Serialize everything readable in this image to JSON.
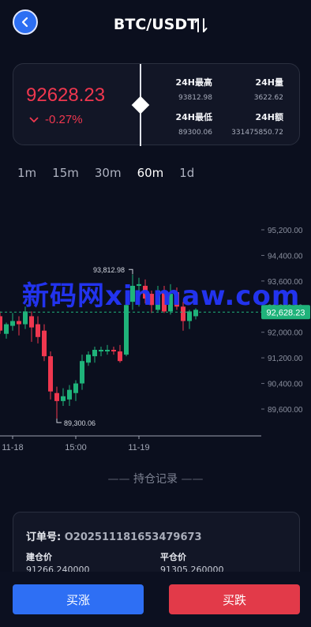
{
  "header": {
    "title": "BTC/USDT",
    "back_icon": "chevron-left-icon",
    "swap_icon": "swap-vertical-icon"
  },
  "ticker": {
    "price": "92628.23",
    "change": "-0.27%",
    "change_icon": "chevron-down-icon",
    "high_label": "24H最高",
    "high_value": "93812.98",
    "volume_label": "24H量",
    "volume_value": "3622.62",
    "low_label": "24H最低",
    "low_value": "89300.06",
    "amount_label": "24H额",
    "amount_value": "331475850.72",
    "up_color": "#1fb37a",
    "down_color": "#f0374f"
  },
  "intervals": [
    {
      "label": "1m",
      "active": false
    },
    {
      "label": "15m",
      "active": false
    },
    {
      "label": "30m",
      "active": false
    },
    {
      "label": "60m",
      "active": true
    },
    {
      "label": "1d",
      "active": false
    }
  ],
  "chart_data": {
    "type": "candlestick",
    "y_ticks": [
      "95,200.00",
      "94,400.00",
      "93,600.00",
      "92,800.00",
      "92,000.00",
      "91,200.00",
      "90,400.00",
      "89,600.00"
    ],
    "x_ticks": [
      "11-18",
      "15:00",
      "11-19"
    ],
    "last_price": "92,628.23",
    "max_label": "93,812.98",
    "min_label": "89,300.06",
    "ylim": [
      89000,
      95600
    ]
  },
  "watermark": "新码网xinmaw.com",
  "positions": {
    "section_title": "持仓记录",
    "order_label": "订单号:",
    "order_no": "O2025111816534796​73",
    "open_label": "建仓价",
    "open_value": "91266.240000",
    "close_label": "平仓价",
    "close_value": "91305.260000"
  },
  "actions": {
    "buy_up": "买涨",
    "buy_down": "买跌"
  }
}
